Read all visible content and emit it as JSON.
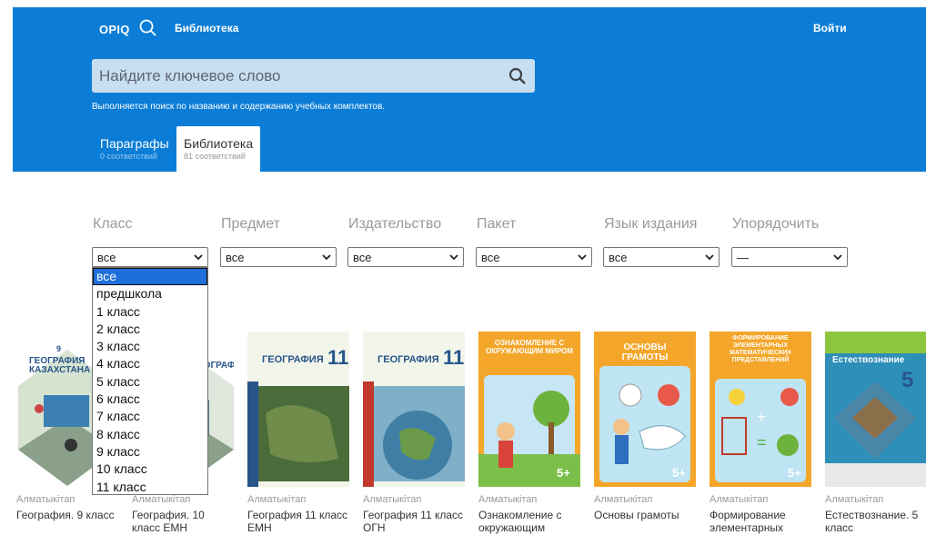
{
  "header": {
    "logo": "ОРІQ",
    "nav_library": "Библиотека",
    "login": "Войти"
  },
  "search": {
    "placeholder": "Найдите ключевое слово",
    "hint": "Выполняется поиск по названию и содержанию учебных комплектов."
  },
  "tabs": [
    {
      "label": "Параграфы",
      "count": "0 соответствий"
    },
    {
      "label": "Библиотека",
      "count": "81 соответствий"
    }
  ],
  "filters": [
    {
      "label": "Класс",
      "value": "все"
    },
    {
      "label": "Предмет",
      "value": "все"
    },
    {
      "label": "Издательство",
      "value": "все"
    },
    {
      "label": "Пакет",
      "value": "все"
    },
    {
      "label": "Язык издания",
      "value": "все"
    },
    {
      "label": "Упорядочить",
      "value": "—"
    }
  ],
  "class_dropdown": {
    "options": [
      "все",
      "предшкола",
      "1 класс",
      "2 класс",
      "3 класс",
      "4 класс",
      "5 класс",
      "6 класс",
      "7 класс",
      "8 класс",
      "9 класс",
      "10 класс",
      "11 класс"
    ],
    "selected": "все"
  },
  "books": [
    {
      "publisher": "Алматыкітап",
      "title": "География. 9 класс",
      "cover_text": "ГЕОГРАФИЯ КАЗАХСТАНА",
      "cover_badge": "9"
    },
    {
      "publisher": "Алматыкітап",
      "title": "География. 10 класс ЕМН",
      "cover_text": "ЕОГРАФИЯ",
      "cover_badge": ""
    },
    {
      "publisher": "Алматыкітап",
      "title": "География 11 класс ЕМН",
      "cover_text": "ГЕОГРАФИЯ",
      "cover_badge": "11"
    },
    {
      "publisher": "Алматыкітап",
      "title": "География 11 класс ОГН",
      "cover_text": "ГЕОГРАФИЯ",
      "cover_badge": "11"
    },
    {
      "publisher": "Алматыкітап",
      "title": "Ознакомление с окружающим",
      "cover_text": "ОЗНАКОМЛЕНИЕ С ОКРУЖАЮЩИМ МИРОМ",
      "cover_badge": "5+"
    },
    {
      "publisher": "Алматыкітап",
      "title": "Основы грамоты",
      "cover_text": "ОСНОВЫ ГРАМОТЫ",
      "cover_badge": "5+"
    },
    {
      "publisher": "Алматыкітап",
      "title": "Формирование элементарных",
      "cover_text": "ФОРМИРОВАНИЕ ЭЛЕМЕНТАРНЫХ МАТЕМАТИЧЕСКИХ ПРЕДСТАВЛЕНИЙ",
      "cover_badge": "5+"
    },
    {
      "publisher": "Алматыкітап",
      "title": "Естествознание. 5 класс",
      "cover_text": "Естествознание",
      "cover_badge": "5"
    }
  ],
  "colors": {
    "header_bg": "#0b7dd6",
    "dropdown_selected": "#1e6fd9"
  }
}
